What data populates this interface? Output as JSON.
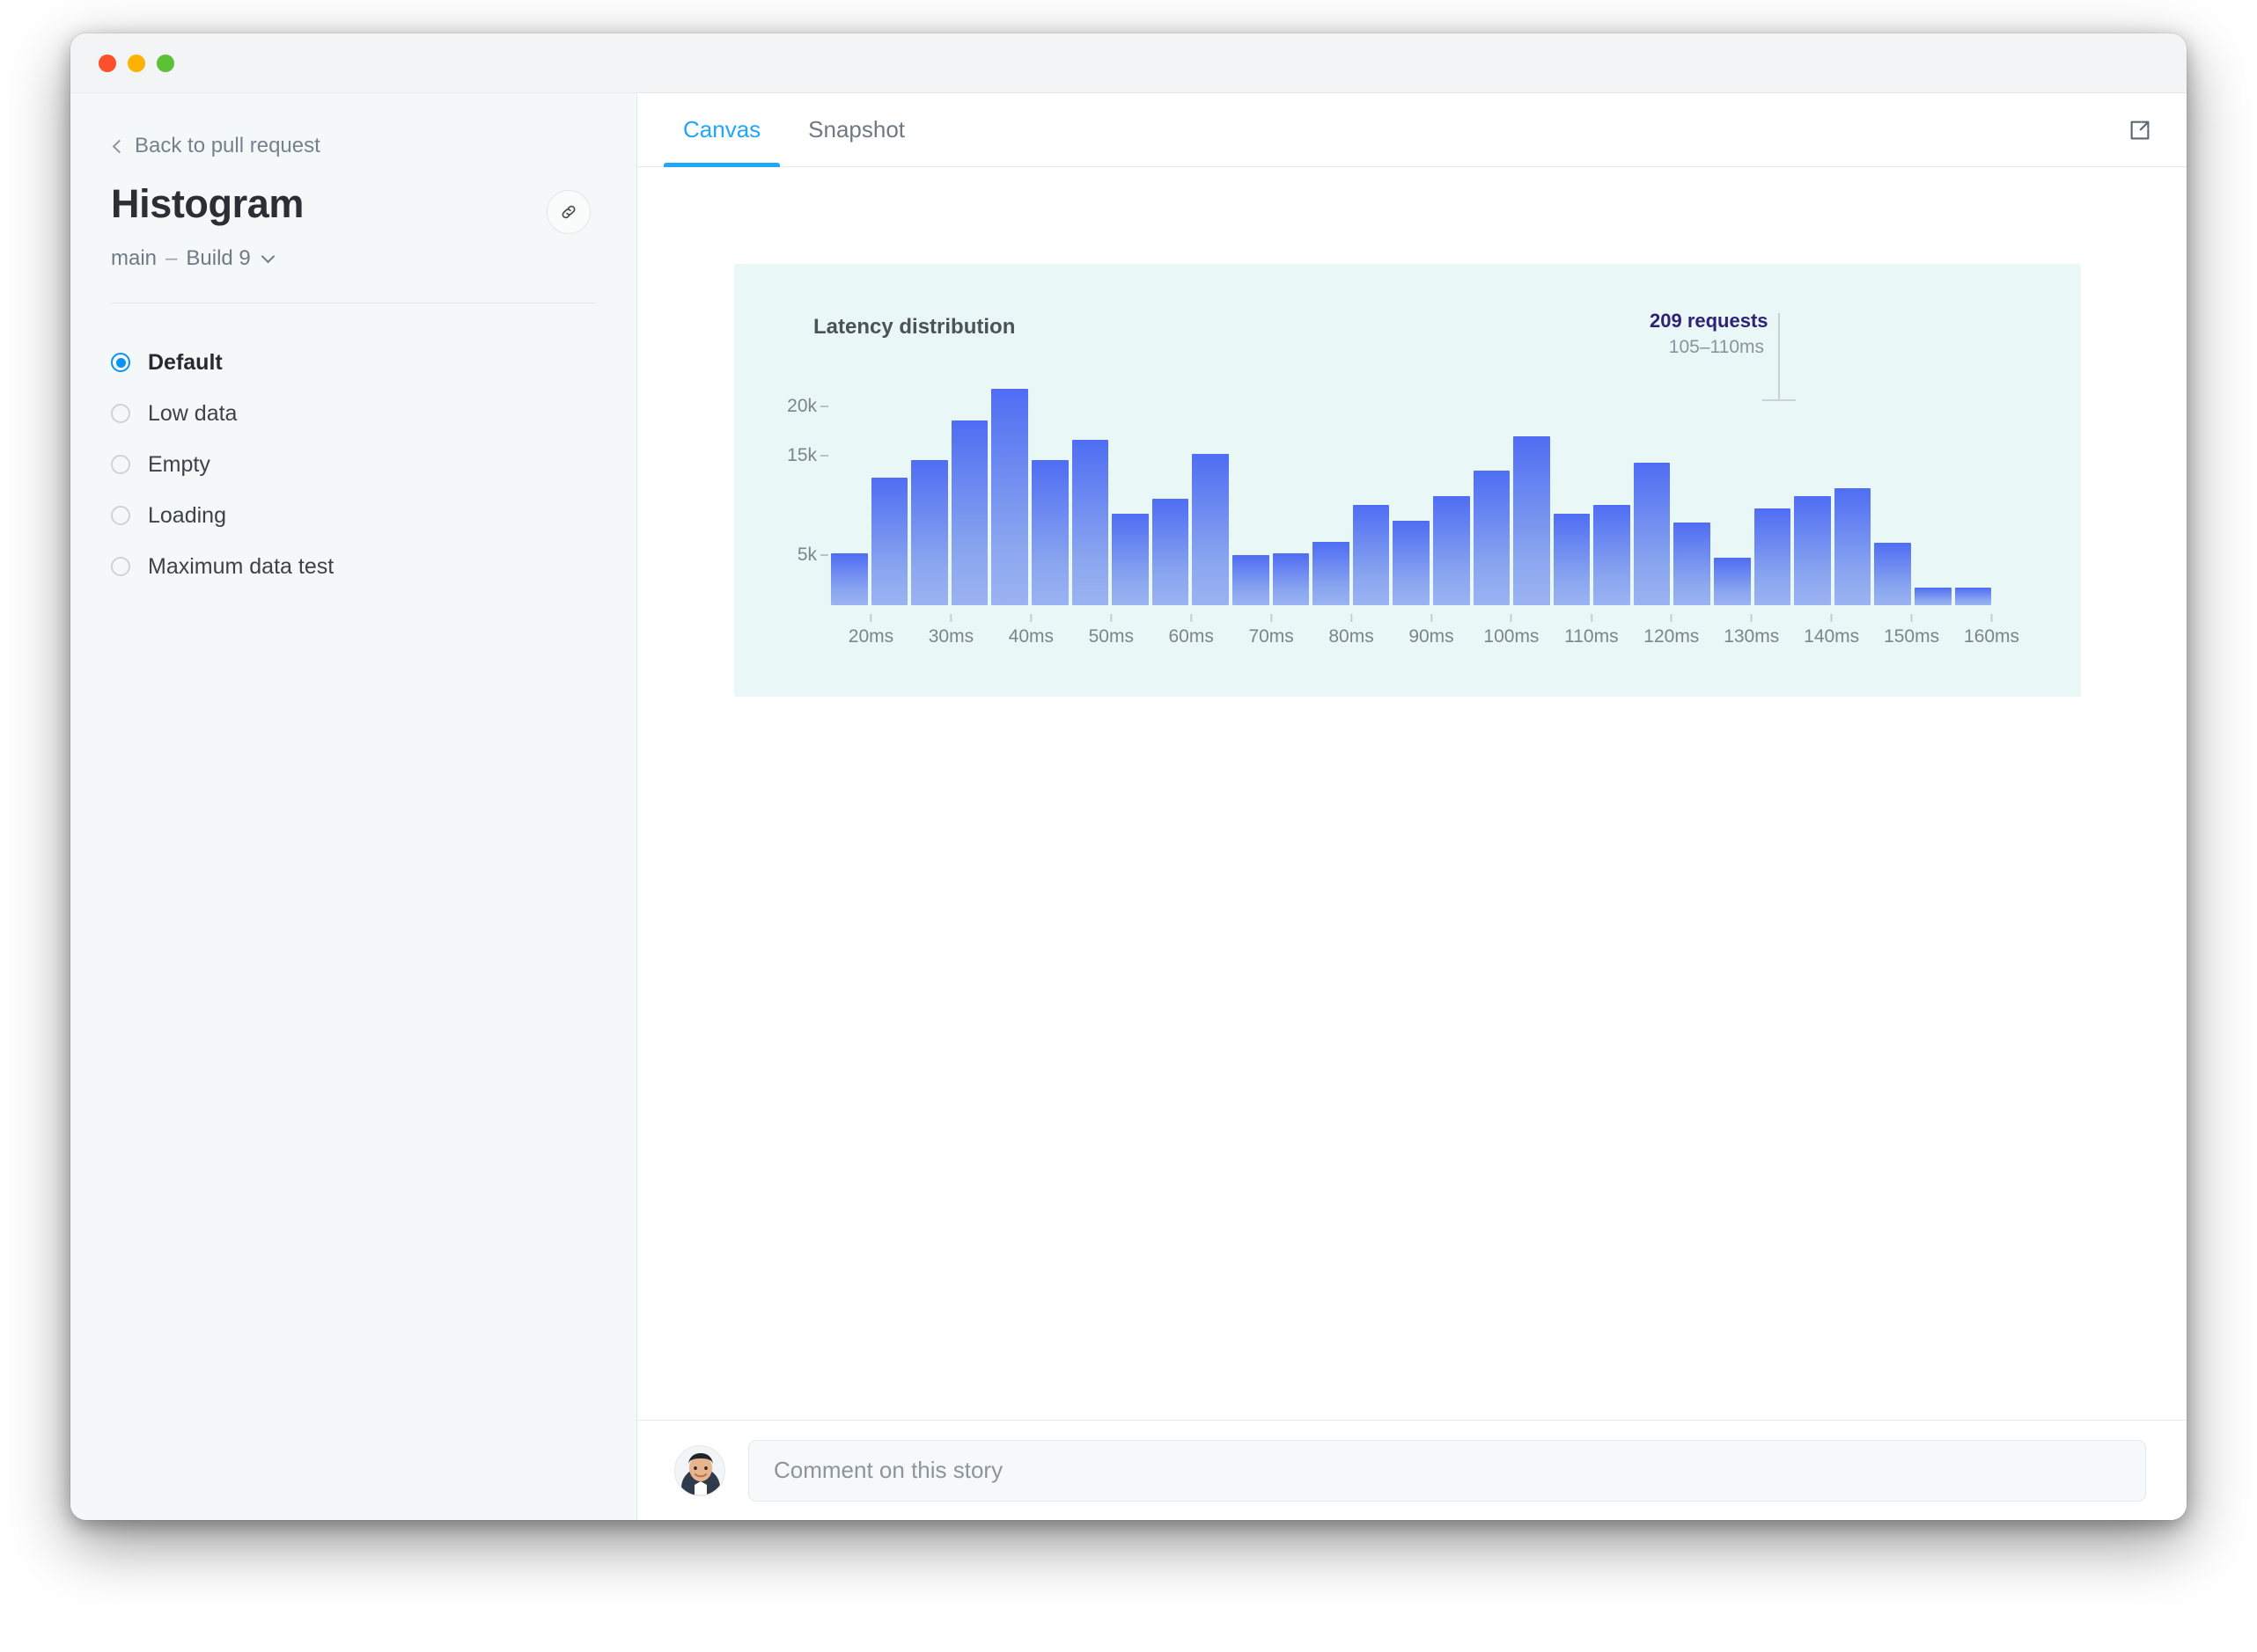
{
  "window": {
    "traffic_lights": [
      "close",
      "minimize",
      "zoom"
    ],
    "colors": {
      "red": "#fc4f2a",
      "amber": "#fdb203",
      "green": "#5cc135"
    }
  },
  "sidebar": {
    "back_label": "Back to pull request",
    "title": "Histogram",
    "branch": "main",
    "separator": "–",
    "build": "Build 9",
    "link_icon": "link-icon",
    "stories": [
      {
        "label": "Default",
        "selected": true
      },
      {
        "label": "Low data",
        "selected": false
      },
      {
        "label": "Empty",
        "selected": false
      },
      {
        "label": "Loading",
        "selected": false
      },
      {
        "label": "Maximum data test",
        "selected": false
      }
    ]
  },
  "main": {
    "tabs": [
      {
        "label": "Canvas",
        "active": true
      },
      {
        "label": "Snapshot",
        "active": false
      }
    ],
    "open_external_icon": "external-link-icon",
    "accent": "#1ea7fd"
  },
  "comment": {
    "placeholder": "Comment on this story",
    "avatar": "user-avatar"
  },
  "chart_data": {
    "type": "bar",
    "title": "Latency distribution",
    "xlabel": "",
    "ylabel": "",
    "grid": false,
    "legend": null,
    "ylim": [
      0,
      23000
    ],
    "ytick_labels": [
      "20k",
      "15k",
      "5k"
    ],
    "ytick_values": [
      20000,
      15000,
      5000
    ],
    "xtick_labels": [
      "20ms",
      "30ms",
      "40ms",
      "50ms",
      "60ms",
      "70ms",
      "80ms",
      "90ms",
      "100ms",
      "110ms",
      "120ms",
      "130ms",
      "140ms",
      "150ms",
      "160ms"
    ],
    "xtick_values": [
      20,
      30,
      40,
      50,
      60,
      70,
      80,
      90,
      100,
      110,
      120,
      130,
      140,
      150,
      160
    ],
    "bin_width_ms": 5,
    "bar_color_top": "#4f6df3",
    "bar_color_bottom": "#9bb3f2",
    "categories": [
      "17.5ms",
      "22.5ms",
      "27.5ms",
      "32.5ms",
      "37.5ms",
      "42.5ms",
      "47.5ms",
      "52.5ms",
      "57.5ms",
      "62.5ms",
      "67.5ms",
      "72.5ms",
      "77.5ms",
      "82.5ms",
      "87.5ms",
      "92.5ms",
      "97.5ms",
      "102.5ms",
      "107.5ms",
      "112.5ms",
      "117.5ms",
      "122.5ms",
      "127.5ms",
      "132.5ms",
      "137.5ms",
      "142.5ms",
      "147.5ms",
      "152.5ms",
      "157.5ms",
      "162.5ms"
    ],
    "values": [
      5200,
      12800,
      14600,
      18600,
      21800,
      14600,
      16600,
      9200,
      10700,
      15200,
      5000,
      5200,
      6400,
      10100,
      8500,
      11000,
      13500,
      17000,
      9200,
      10100,
      14300,
      8300,
      4800,
      9700,
      11000,
      11800,
      6300,
      1800,
      1800,
      0
    ],
    "annotation": {
      "title": "209 requests",
      "subtitle": "105–110ms",
      "target_bin_index": 17,
      "title_color": "#2e2176",
      "subtitle_color": "#8a949b"
    }
  }
}
